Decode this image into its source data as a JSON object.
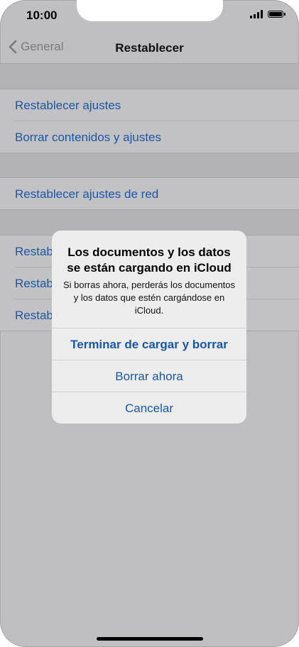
{
  "status_bar": {
    "time": "10:00"
  },
  "nav": {
    "back_label": "General",
    "title": "Restablecer"
  },
  "settings": {
    "items": [
      {
        "label": "Restablecer ajustes"
      },
      {
        "label": "Borrar contenidos y ajustes"
      },
      {
        "label": "Restablecer ajustes de red"
      },
      {
        "label": "Restab"
      },
      {
        "label": "Restab"
      },
      {
        "label": "Restab"
      }
    ]
  },
  "alert": {
    "title": "Los documentos y los datos se están cargando en iCloud",
    "message": "Si borras ahora, perderás los documentos y los datos que estén cargándose en iCloud.",
    "buttons": [
      {
        "label": "Terminar de cargar y borrar"
      },
      {
        "label": "Borrar ahora"
      },
      {
        "label": "Cancelar"
      }
    ]
  },
  "colors": {
    "accent": "#1b56a8",
    "dim_background": "#bfbfc1",
    "alert_background": "#ededed"
  },
  "icons": {
    "back": "chevron-left-icon",
    "signal": "cellular-signal-icon",
    "battery": "battery-icon"
  }
}
